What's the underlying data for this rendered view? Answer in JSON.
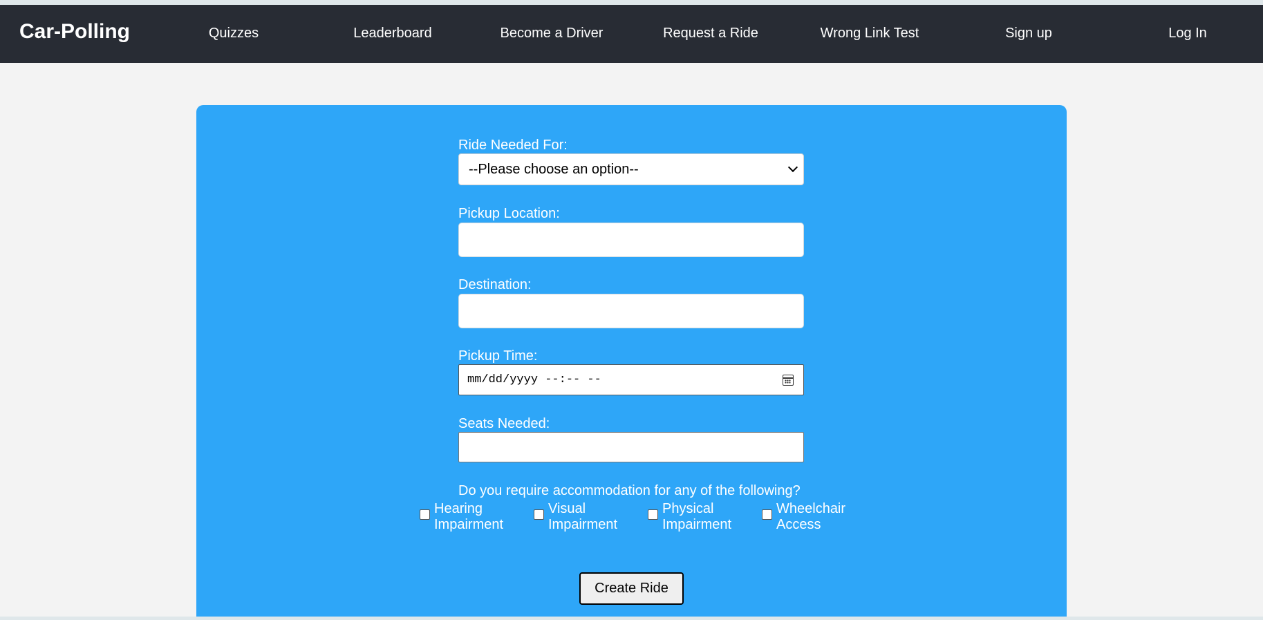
{
  "navbar": {
    "brand": "Car-Polling",
    "links": [
      {
        "label": "Quizzes"
      },
      {
        "label": "Leaderboard"
      },
      {
        "label": "Become a Driver"
      },
      {
        "label": "Request a Ride"
      },
      {
        "label": "Wrong Link Test"
      },
      {
        "label": "Sign up"
      },
      {
        "label": "Log In"
      }
    ]
  },
  "form": {
    "ride_for_label": "Ride Needed For:",
    "ride_for_selected": "--Please choose an option--",
    "pickup_label": "Pickup Location:",
    "pickup_value": "",
    "destination_label": "Destination:",
    "destination_value": "",
    "time_label": "Pickup Time:",
    "time_placeholder": "mm/dd/yyyy --:-- --",
    "seats_label": "Seats Needed:",
    "seats_value": "",
    "accommodation_question": "Do you require accommodation for any of the following?",
    "accommodations": [
      {
        "label": "Hearing Impairment",
        "checked": false
      },
      {
        "label": "Visual Impairment",
        "checked": false
      },
      {
        "label": "Physical Impairment",
        "checked": false
      },
      {
        "label": "Wheelchair Access",
        "checked": false
      }
    ],
    "submit_label": "Create Ride"
  },
  "colors": {
    "navbar_bg": "#282c34",
    "card_bg": "#2ea6f8",
    "page_bg": "#f3f3f3"
  }
}
